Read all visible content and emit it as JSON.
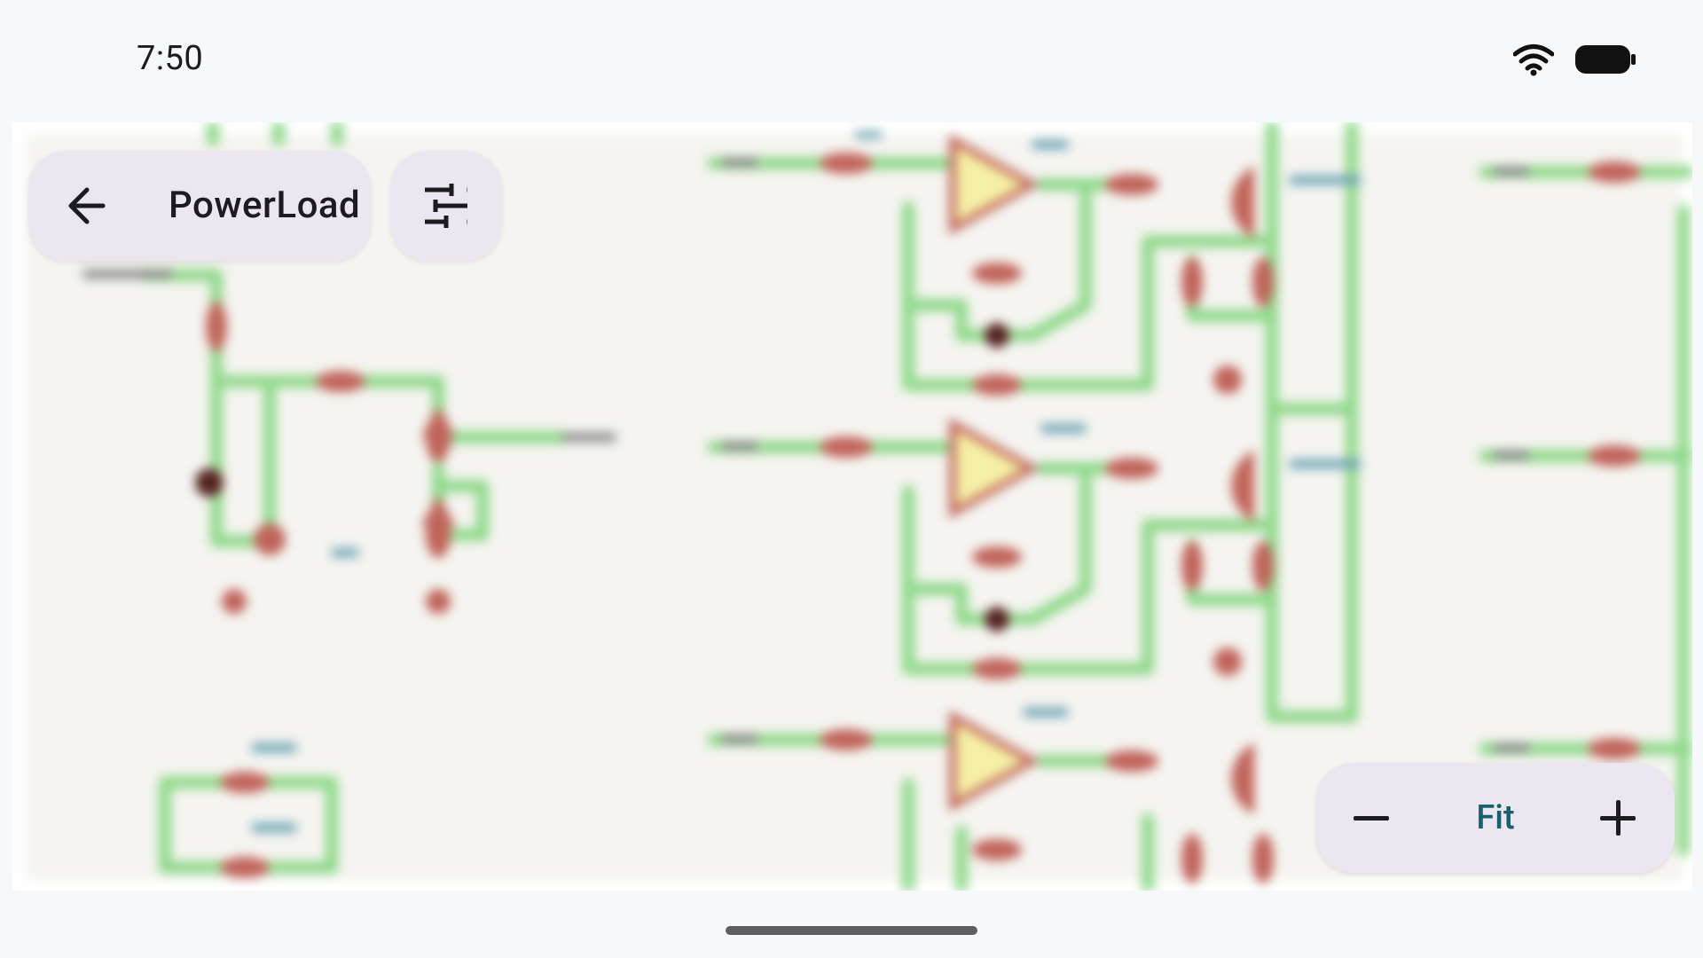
{
  "status_bar": {
    "time": "7:50",
    "icons": [
      "wifi-icon",
      "battery-icon"
    ]
  },
  "toolbar": {
    "title": "PowerLoad",
    "back_icon": "arrow-back-icon",
    "filter_icon": "tune-sliders-icon"
  },
  "zoom": {
    "minus_icon": "zoom-out-minus-icon",
    "fit_label": "Fit",
    "plus_icon": "zoom-in-plus-icon"
  },
  "colors": {
    "background": "#f7f8fa",
    "pill": "#ebe6f0",
    "accent_text": "#17616b",
    "wire": "#8fd98a",
    "component": "#c0645a",
    "opamp_fill": "#f6f0a6",
    "canvas": "#f5f4f0"
  }
}
